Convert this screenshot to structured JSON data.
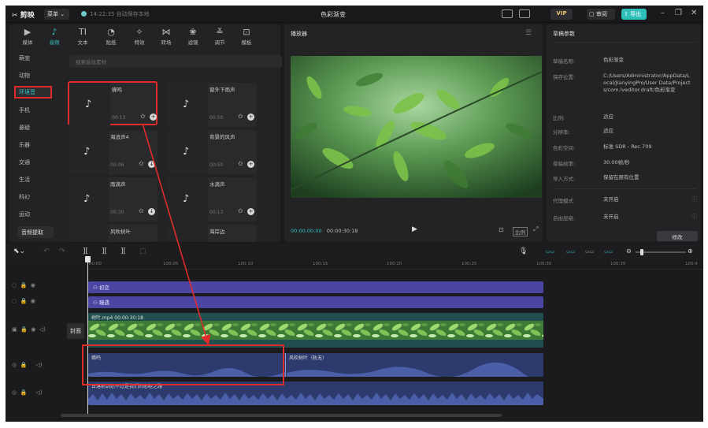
{
  "titlebar": {
    "logo": "✂ 剪映",
    "menu": "菜单 ⌄",
    "autosave": "14:22:35 自动保存本地",
    "title": "色彩渐变",
    "vip": "VIP",
    "review": "审阅",
    "export": "导出"
  },
  "toolbar": [
    {
      "icon": "▶",
      "label": "媒体"
    },
    {
      "icon": "♪",
      "label": "音频"
    },
    {
      "icon": "TI",
      "label": "文本"
    },
    {
      "icon": "◔",
      "label": "贴纸"
    },
    {
      "icon": "✧",
      "label": "特效"
    },
    {
      "icon": "⋈",
      "label": "转场"
    },
    {
      "icon": "❀",
      "label": "滤镜"
    },
    {
      "icon": "≚",
      "label": "调节"
    },
    {
      "icon": "⊡",
      "label": "模板"
    }
  ],
  "categories": [
    "萌宠",
    "动物",
    "环境音",
    "手机",
    "悬疑",
    "乐器",
    "交通",
    "生活",
    "科幻",
    "运动"
  ],
  "extract_button": "音频提取",
  "search": {
    "placeholder": "搜索音效素材"
  },
  "sounds": [
    {
      "name": "蝉鸣",
      "duration": "00:13"
    },
    {
      "name": "窗外下雨声",
      "duration": "00:50"
    },
    {
      "name": "海浪声4",
      "duration": "00:06"
    },
    {
      "name": "背景的风声",
      "duration": "00:50"
    },
    {
      "name": "雨滴声",
      "duration": "00:30"
    },
    {
      "name": "水滴声",
      "duration": "00:13"
    },
    {
      "name": "风吹树叶",
      "duration": ""
    },
    {
      "name": "海岸边",
      "duration": ""
    }
  ],
  "player": {
    "title": "播放器",
    "current": "00:00:00:00",
    "total": "00:00:30:18",
    "ratio": "比例"
  },
  "params": {
    "title": "草稿参数",
    "rows": [
      {
        "label": "草稿名称:",
        "value": "色彩渐变"
      },
      {
        "label": "保存位置:",
        "value": "C:/Users/Administrator/AppData/Local/JianyingPro/User Data/Projects/com.lveditor.draft/色彩渐变"
      },
      {
        "label": "比例:",
        "value": "适应"
      },
      {
        "label": "分辨率:",
        "value": "适应"
      },
      {
        "label": "色彩空间:",
        "value": "标准 SDR - Rec.709"
      },
      {
        "label": "草稿帧率:",
        "value": "30.00帧/秒"
      },
      {
        "label": "导入方式:",
        "value": "保留在原有位置"
      },
      {
        "label": "代理模式",
        "value": "未开启"
      },
      {
        "label": "自由层级:",
        "value": "未开启"
      }
    ],
    "modify": "修改"
  },
  "timeline": {
    "ticks": [
      "00:00",
      "100:05",
      "100:10",
      "100:15",
      "100:20",
      "100:25",
      "100:30",
      "100:35",
      "100:4"
    ],
    "track1_label": "初恋",
    "track2_label": "瞳遇",
    "video_label": "树叶.mp4  00:00:30:18",
    "cover_label": "封面",
    "audio1_label": "蝉鸣",
    "audio1b_label": "风吹树叶（轨无）",
    "audio2_label": "日落前到达不过是我们的必经之路"
  }
}
